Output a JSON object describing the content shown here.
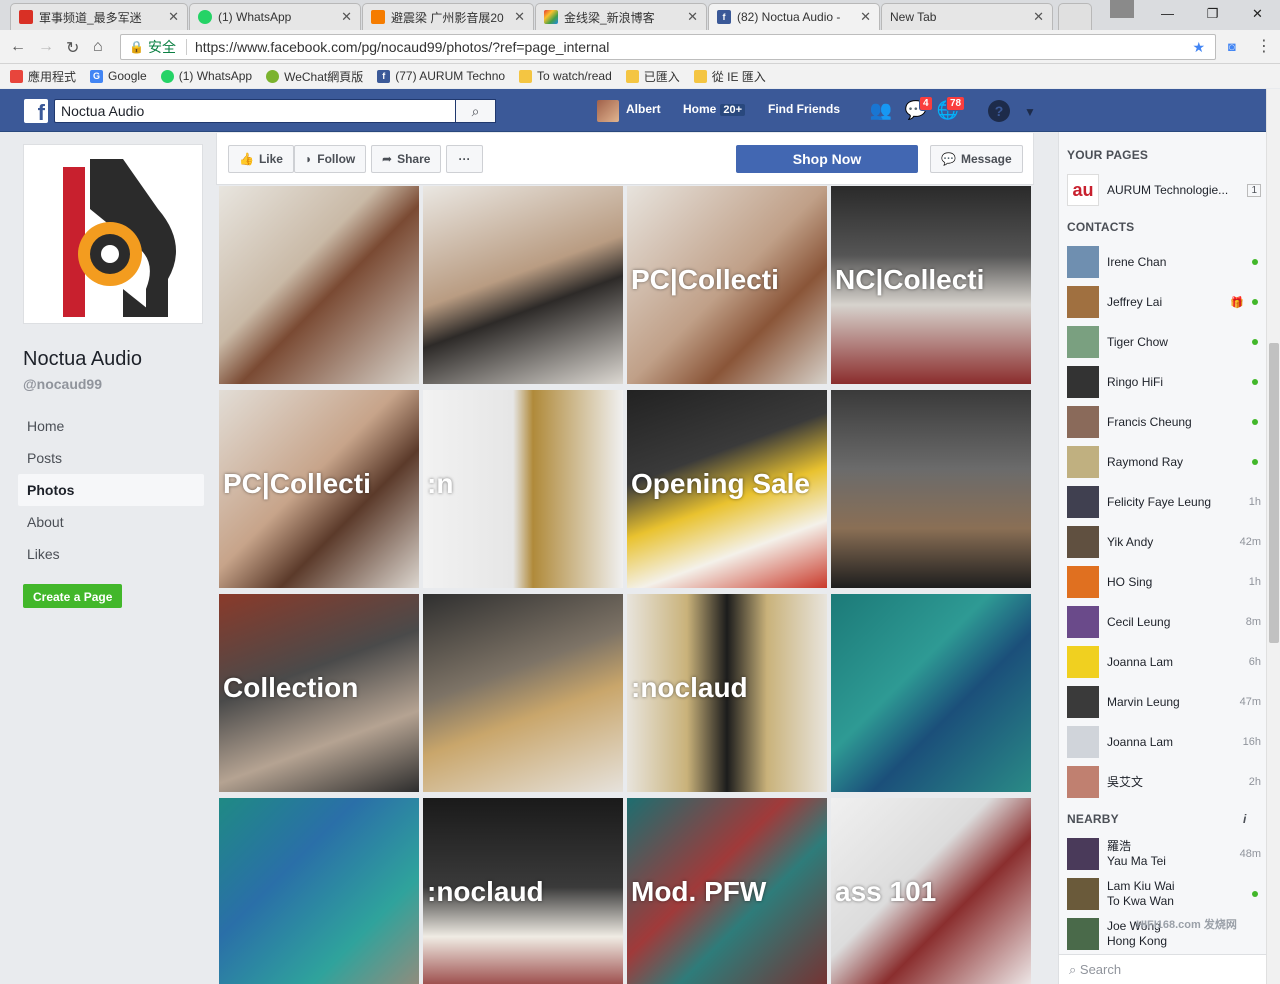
{
  "browser": {
    "tabs": [
      {
        "title": "軍事频道_最多军迷",
        "fav_color": "#d93025"
      },
      {
        "title": "(1) WhatsApp",
        "fav_color": "#25d366"
      },
      {
        "title": "避震梁 广州影音展20",
        "fav_color": "#f57c00"
      },
      {
        "title": "金线梁_新浪博客",
        "fav_color": "#7b1fa2"
      },
      {
        "title": "(82) Noctua Audio -",
        "fav_color": "#3b5998"
      },
      {
        "title": "New Tab",
        "fav_color": ""
      }
    ],
    "secure_label": "安全",
    "url": "https://www.facebook.com/pg/nocaud99/photos/?ref=page_internal",
    "bookmarks": [
      {
        "label": "應用程式",
        "color": "#e8453c"
      },
      {
        "label": "Google",
        "color": "#4285f4"
      },
      {
        "label": "(1) WhatsApp",
        "color": "#25d366"
      },
      {
        "label": "WeChat網頁版",
        "color": "#7bb32e"
      },
      {
        "label": "(77) AURUM Techno",
        "color": "#3b5998"
      },
      {
        "label": "To watch/read",
        "color": "#f4c542"
      },
      {
        "label": "已匯入",
        "color": "#f4c542"
      },
      {
        "label": "從 IE 匯入",
        "color": "#f4c542"
      }
    ]
  },
  "fb": {
    "search_value": "Noctua Audio",
    "user_name": "Albert",
    "home_label": "Home",
    "home_badge": "20+",
    "find_friends": "Find Friends",
    "messages_count": "4",
    "notifications_count": "78"
  },
  "page": {
    "name": "Noctua Audio",
    "handle": "@nocaud99",
    "nav": [
      "Home",
      "Posts",
      "Photos",
      "About",
      "Likes"
    ],
    "active_nav": "Photos",
    "create_page": "Create a Page"
  },
  "actions": {
    "like": "Like",
    "follow": "Follow",
    "share": "Share",
    "more": "···",
    "shop_now": "Shop Now",
    "message": "Message"
  },
  "photos": [
    {
      "overlay": "",
      "bg": "linear-gradient(135deg,#e8e5df 0%,#c9b9a6 40%,#7a4a33 55%,#d8d3cb 100%)"
    },
    {
      "overlay": "",
      "bg": "linear-gradient(160deg,#eae7e2 0%,#b99c82 45%,#2d2a28 60%,#dcd8d2 100%)"
    },
    {
      "overlay": "PC|Collecti",
      "bg": "linear-gradient(135deg,#e7e3dd 0%,#c0a088 50%,#8a5538 70%,#d6d0c8 100%)"
    },
    {
      "overlay": "NC|Collecti",
      "bg": "linear-gradient(180deg,#2a2a2a 0%,#555 35%,#d7d3cd 60%,#8b2d2d 100%)"
    },
    {
      "overlay": "PC|Collecti",
      "bg": "linear-gradient(135deg,#e2ddd6 0%,#c7a48a 45%,#5b3a2a 65%,#dcd6cf 100%)"
    },
    {
      "overlay": ":n",
      "bg": "linear-gradient(90deg,#f2f2f2 0%,#e6e6e6 45%,#b08a3a 55%,#f0f0f0 100%)"
    },
    {
      "overlay": "Opening Sale",
      "bg": "linear-gradient(160deg,#222 0%,#3a3a3a 35%,#e9c22f 55%,#f4f1ea 75%,#c93a2b 100%)"
    },
    {
      "overlay": "",
      "bg": "linear-gradient(180deg,#3a3a3a 0%,#6b6b6b 40%,#8a6f55 70%,#1e1e1e 100%)"
    },
    {
      "overlay": "Collection",
      "bg": "linear-gradient(160deg,#8a3a2a 0%,#4a4a4a 40%,#b5a392 70%,#2d2d2d 100%)"
    },
    {
      "overlay": "",
      "bg": "linear-gradient(160deg,#2f2f2f 0%,#7d7366 40%,#c9a66b 60%,#e6e2dc 100%)"
    },
    {
      "overlay": ":noclaud",
      "bg": "linear-gradient(90deg,#e8e4dc 0%,#c9b27a 30%,#1c1c1c 50%,#c9b27a 70%,#e8e4dc 100%)"
    },
    {
      "overlay": "",
      "bg": "linear-gradient(135deg,#1c7a78 0%,#2e9a94 40%,#1b4f7a 60%,#2a8a86 100%)"
    },
    {
      "overlay": "",
      "bg": "linear-gradient(135deg,#1f8a84 0%,#2a6fa8 35%,#2fa39c 70%,#9a8a7a 100%)"
    },
    {
      "overlay": ":noclaud",
      "bg": "linear-gradient(180deg,#1a1a1a 0%,#3a3a3a 45%,#f0ece4 70%,#8a2a2a 100%)"
    },
    {
      "overlay": "Mod. PFW",
      "bg": "linear-gradient(135deg,#1d6e70 0%,#a03a3a 40%,#2e7c7a 60%,#7a2e2e 100%)"
    },
    {
      "overlay": "ass 101",
      "bg": "linear-gradient(135deg,#f0f0f0 0%,#dcdcdc 40%,#8a2e2e 60%,#f4f4f4 100%)"
    }
  ],
  "sidebar": {
    "your_pages_h": "YOUR PAGES",
    "your_page": {
      "name": "AURUM Technologie...",
      "count": "1"
    },
    "contacts_h": "CONTACTS",
    "contacts": [
      {
        "name": "Irene Chan",
        "status": "",
        "online": true,
        "c": "#6f8fb0"
      },
      {
        "name": "Jeffrey Lai",
        "status": "",
        "online": true,
        "c": "#a07040",
        "gift": true
      },
      {
        "name": "Tiger Chow",
        "status": "",
        "online": true,
        "c": "#7aa080"
      },
      {
        "name": "Ringo HiFi",
        "status": "",
        "online": true,
        "c": "#333333"
      },
      {
        "name": "Francis Cheung",
        "status": "",
        "online": true,
        "c": "#8a6a5a"
      },
      {
        "name": "Raymond Ray",
        "status": "",
        "online": true,
        "c": "#c0b080"
      },
      {
        "name": "Felicity Faye Leung",
        "status": "1h",
        "online": false,
        "c": "#404050"
      },
      {
        "name": "Yik Andy",
        "status": "42m",
        "online": false,
        "c": "#605040"
      },
      {
        "name": "HO Sing",
        "status": "1h",
        "online": false,
        "c": "#e07020"
      },
      {
        "name": "Cecil Leung",
        "status": "8m",
        "online": false,
        "c": "#6a4a8a"
      },
      {
        "name": "Joanna Lam",
        "status": "6h",
        "online": false,
        "c": "#f0d020"
      },
      {
        "name": "Marvin Leung",
        "status": "47m",
        "online": false,
        "c": "#3a3a3a"
      },
      {
        "name": "Joanna Lam",
        "status": "16h",
        "online": false,
        "c": "#d0d4da"
      },
      {
        "name": "吳艾文",
        "status": "2h",
        "online": false,
        "c": "#c08070"
      }
    ],
    "nearby_h": "NEARBY",
    "nearby": [
      {
        "name": "羅浩",
        "sub": "Yau Ma Tei",
        "status": "48m",
        "online": false,
        "c": "#4a3a5a"
      },
      {
        "name": "Lam Kiu Wai",
        "sub": "To Kwa Wan",
        "status": "",
        "online": true,
        "c": "#6a5a3a"
      },
      {
        "name": "Joe Wong",
        "sub": "Hong Kong",
        "status": "",
        "online": false,
        "c": "#4a6a4a"
      }
    ],
    "search_placeholder": "Search"
  },
  "watermark": "HIFI168.com 发烧网"
}
